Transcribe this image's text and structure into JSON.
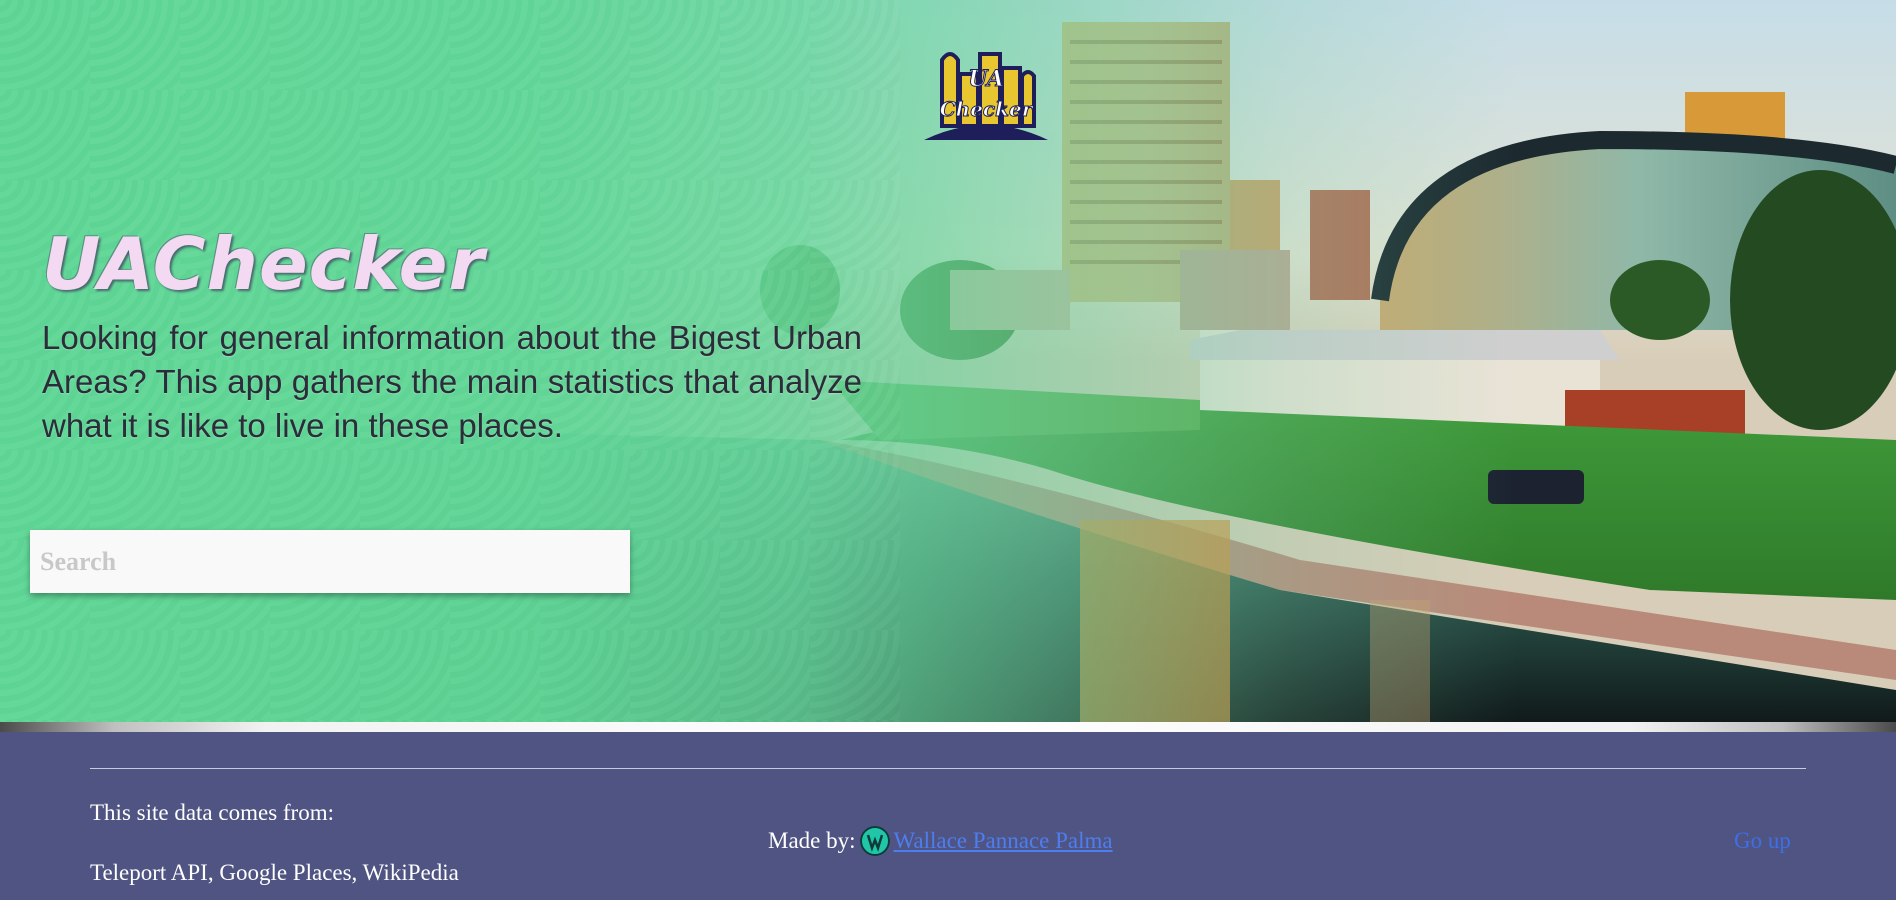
{
  "hero": {
    "logo_text_line1": "UA",
    "logo_text_line2": "Checker",
    "title": "UAChecker",
    "description": "Looking for general information about the Bigest Urban Areas? This app gathers the main statistics that analyze what it is like to live in these places.",
    "search": {
      "placeholder": "Search",
      "value": ""
    }
  },
  "footer": {
    "source_heading": "This site data comes from:",
    "source_list": "Teleport API, Google Places, WikiPedia",
    "made_by_label": "Made by:",
    "author_name": "Wallace Pannace Palma",
    "go_up_label": "Go up"
  },
  "colors": {
    "hero_green": "#5fd796",
    "title_pink": "#f4d9f3",
    "footer_bg": "#4f5482",
    "link_blue": "#4d7ef0"
  },
  "icons": {
    "logo": "ua-checker-city-logo",
    "avatar": "author-avatar-icon"
  }
}
